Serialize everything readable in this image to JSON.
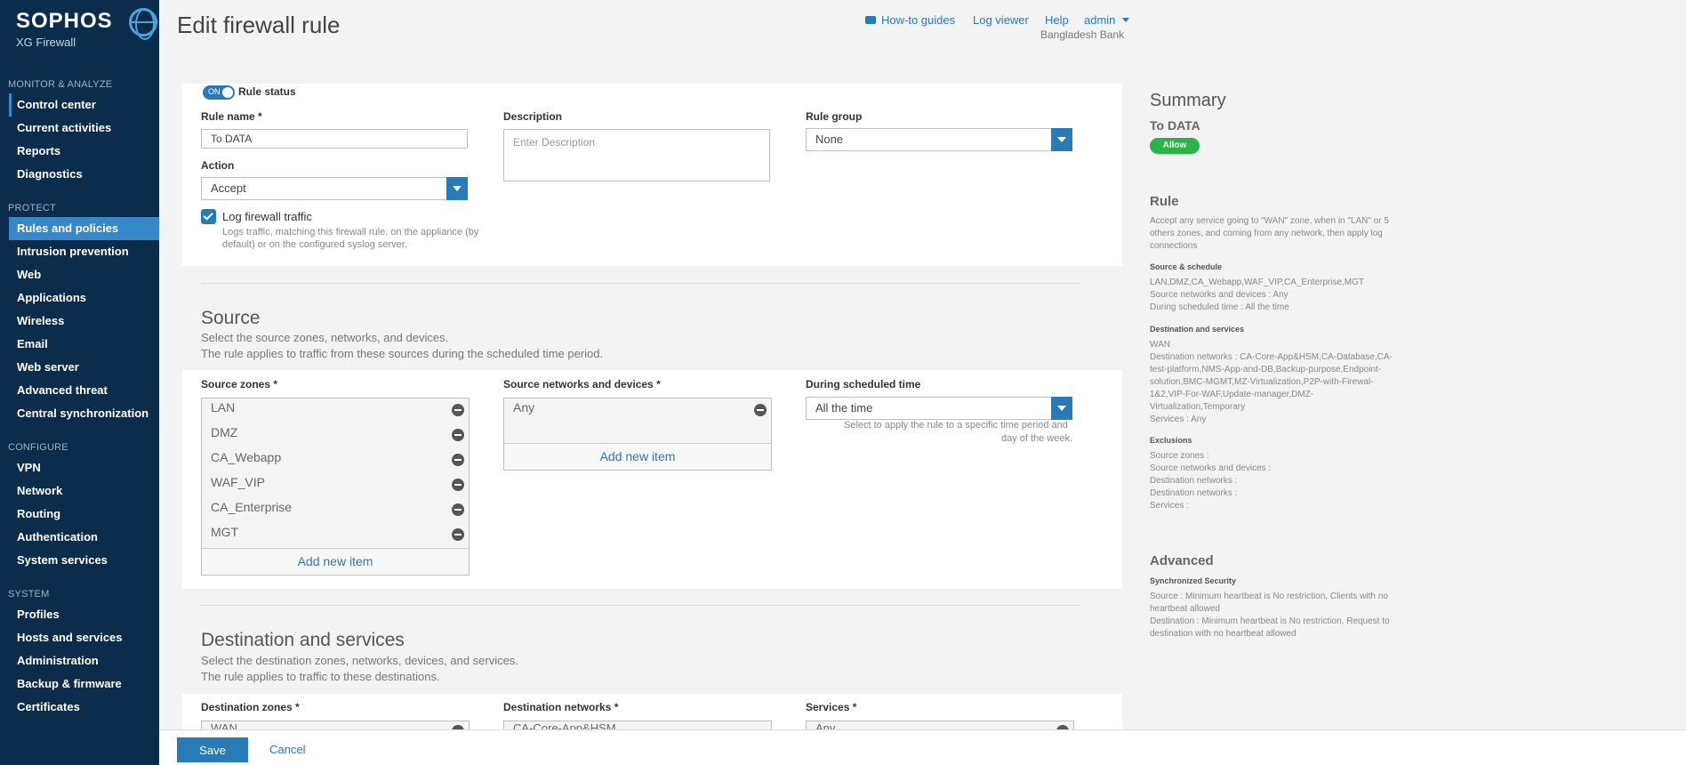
{
  "sidebar": {
    "brand": "SOPHOS",
    "product": "XG Firewall",
    "sections": [
      {
        "title": "MONITOR & ANALYZE",
        "items": [
          "Control center",
          "Current activities",
          "Reports",
          "Diagnostics"
        ]
      },
      {
        "title": "PROTECT",
        "items": [
          "Rules and policies",
          "Intrusion prevention",
          "Web",
          "Applications",
          "Wireless",
          "Email",
          "Web server",
          "Advanced threat",
          "Central synchronization"
        ]
      },
      {
        "title": "CONFIGURE",
        "items": [
          "VPN",
          "Network",
          "Routing",
          "Authentication",
          "System services"
        ]
      },
      {
        "title": "SYSTEM",
        "items": [
          "Profiles",
          "Hosts and services",
          "Administration",
          "Backup & firmware",
          "Certificates"
        ]
      }
    ]
  },
  "header": {
    "title": "Edit firewall rule",
    "howto": "How-to guides",
    "logviewer": "Log viewer",
    "help": "Help",
    "admin": "admin",
    "org": "Bangladesh Bank"
  },
  "rule": {
    "toggle_state": "ON",
    "status_label": "Rule status",
    "name_label": "Rule name *",
    "name_value": "To DATA",
    "desc_label": "Description",
    "desc_placeholder": "Enter Description",
    "group_label": "Rule group",
    "group_value": "None",
    "action_label": "Action",
    "action_value": "Accept",
    "log_label": "Log firewall traffic",
    "log_help_1": "Logs traffic, matching this firewall rule, on the appliance (by",
    "log_help_2": "default) or on the configured syslog server."
  },
  "source": {
    "title": "Source",
    "desc_1": "Select the source zones, networks, and devices.",
    "desc_2": "The rule applies to traffic from these sources during the scheduled time period.",
    "zones_label": "Source zones *",
    "zones": [
      "LAN",
      "DMZ",
      "CA_Webapp",
      "WAF_VIP",
      "CA_Enterprise",
      "MGT"
    ],
    "networks_label": "Source networks and devices *",
    "networks": [
      "Any"
    ],
    "schedule_label": "During scheduled time",
    "schedule_value": "All the time",
    "schedule_help_1": "Select to apply the rule to a specific time period and",
    "schedule_help_2": "day of the week.",
    "add_new": "Add new item"
  },
  "destination": {
    "title": "Destination and services",
    "desc_1": "Select the destination zones, networks, devices, and services.",
    "desc_2": "The rule applies to traffic to these destinations.",
    "zones_label": "Destination zones *",
    "zone_first": "WAN",
    "networks_label": "Destination networks *",
    "network_first": "CA-Core-App&HSM",
    "services_label": "Services *",
    "service_first": "Any"
  },
  "summary": {
    "title": "Summary",
    "rule_name": "To DATA",
    "badge": "Allow",
    "rule_heading": "Rule",
    "rule_text": [
      "Accept any service going to \"WAN\" zone, when in \"LAN\" or 5",
      "others zones, and coming from any network, then apply log",
      "connections"
    ],
    "src_heading": "Source & schedule",
    "src_text": [
      "LAN,DMZ,CA_Webapp,WAF_VIP,CA_Enterprise,MGT",
      "Source networks and devices : Any",
      "During scheduled time : All the time"
    ],
    "dst_heading": "Destination and services",
    "dst_text": [
      "WAN",
      "Destination networks : CA-Core-App&HSM,CA-Database,CA-",
      "test-platform,NMS-App-and-DB,Backup-purpose,Endpoint-",
      "solution,BMC-MGMT,MZ-Virtualization,P2P-with-Firewal-",
      "1&2,VIP-For-WAF,Update-manager,DMZ-",
      "Virtualization,Temporary",
      "Services : Any"
    ],
    "excl_heading": "Exclusions",
    "excl_text": [
      "Source zones :",
      "Source networks and devices :",
      "Destination networks :",
      "Destination networks :",
      "Services :"
    ],
    "adv_heading": "Advanced",
    "sync_heading": "Synchronized Security",
    "adv_text": [
      "Source : Minimum heartbeat is No restriction, Clients with no",
      "heartbeat allowed",
      "Destination : Minimum heartbeat is No restriction, Request to",
      "destination with no heartbeat allowed"
    ]
  },
  "footer": {
    "save": "Save",
    "cancel": "Cancel"
  }
}
